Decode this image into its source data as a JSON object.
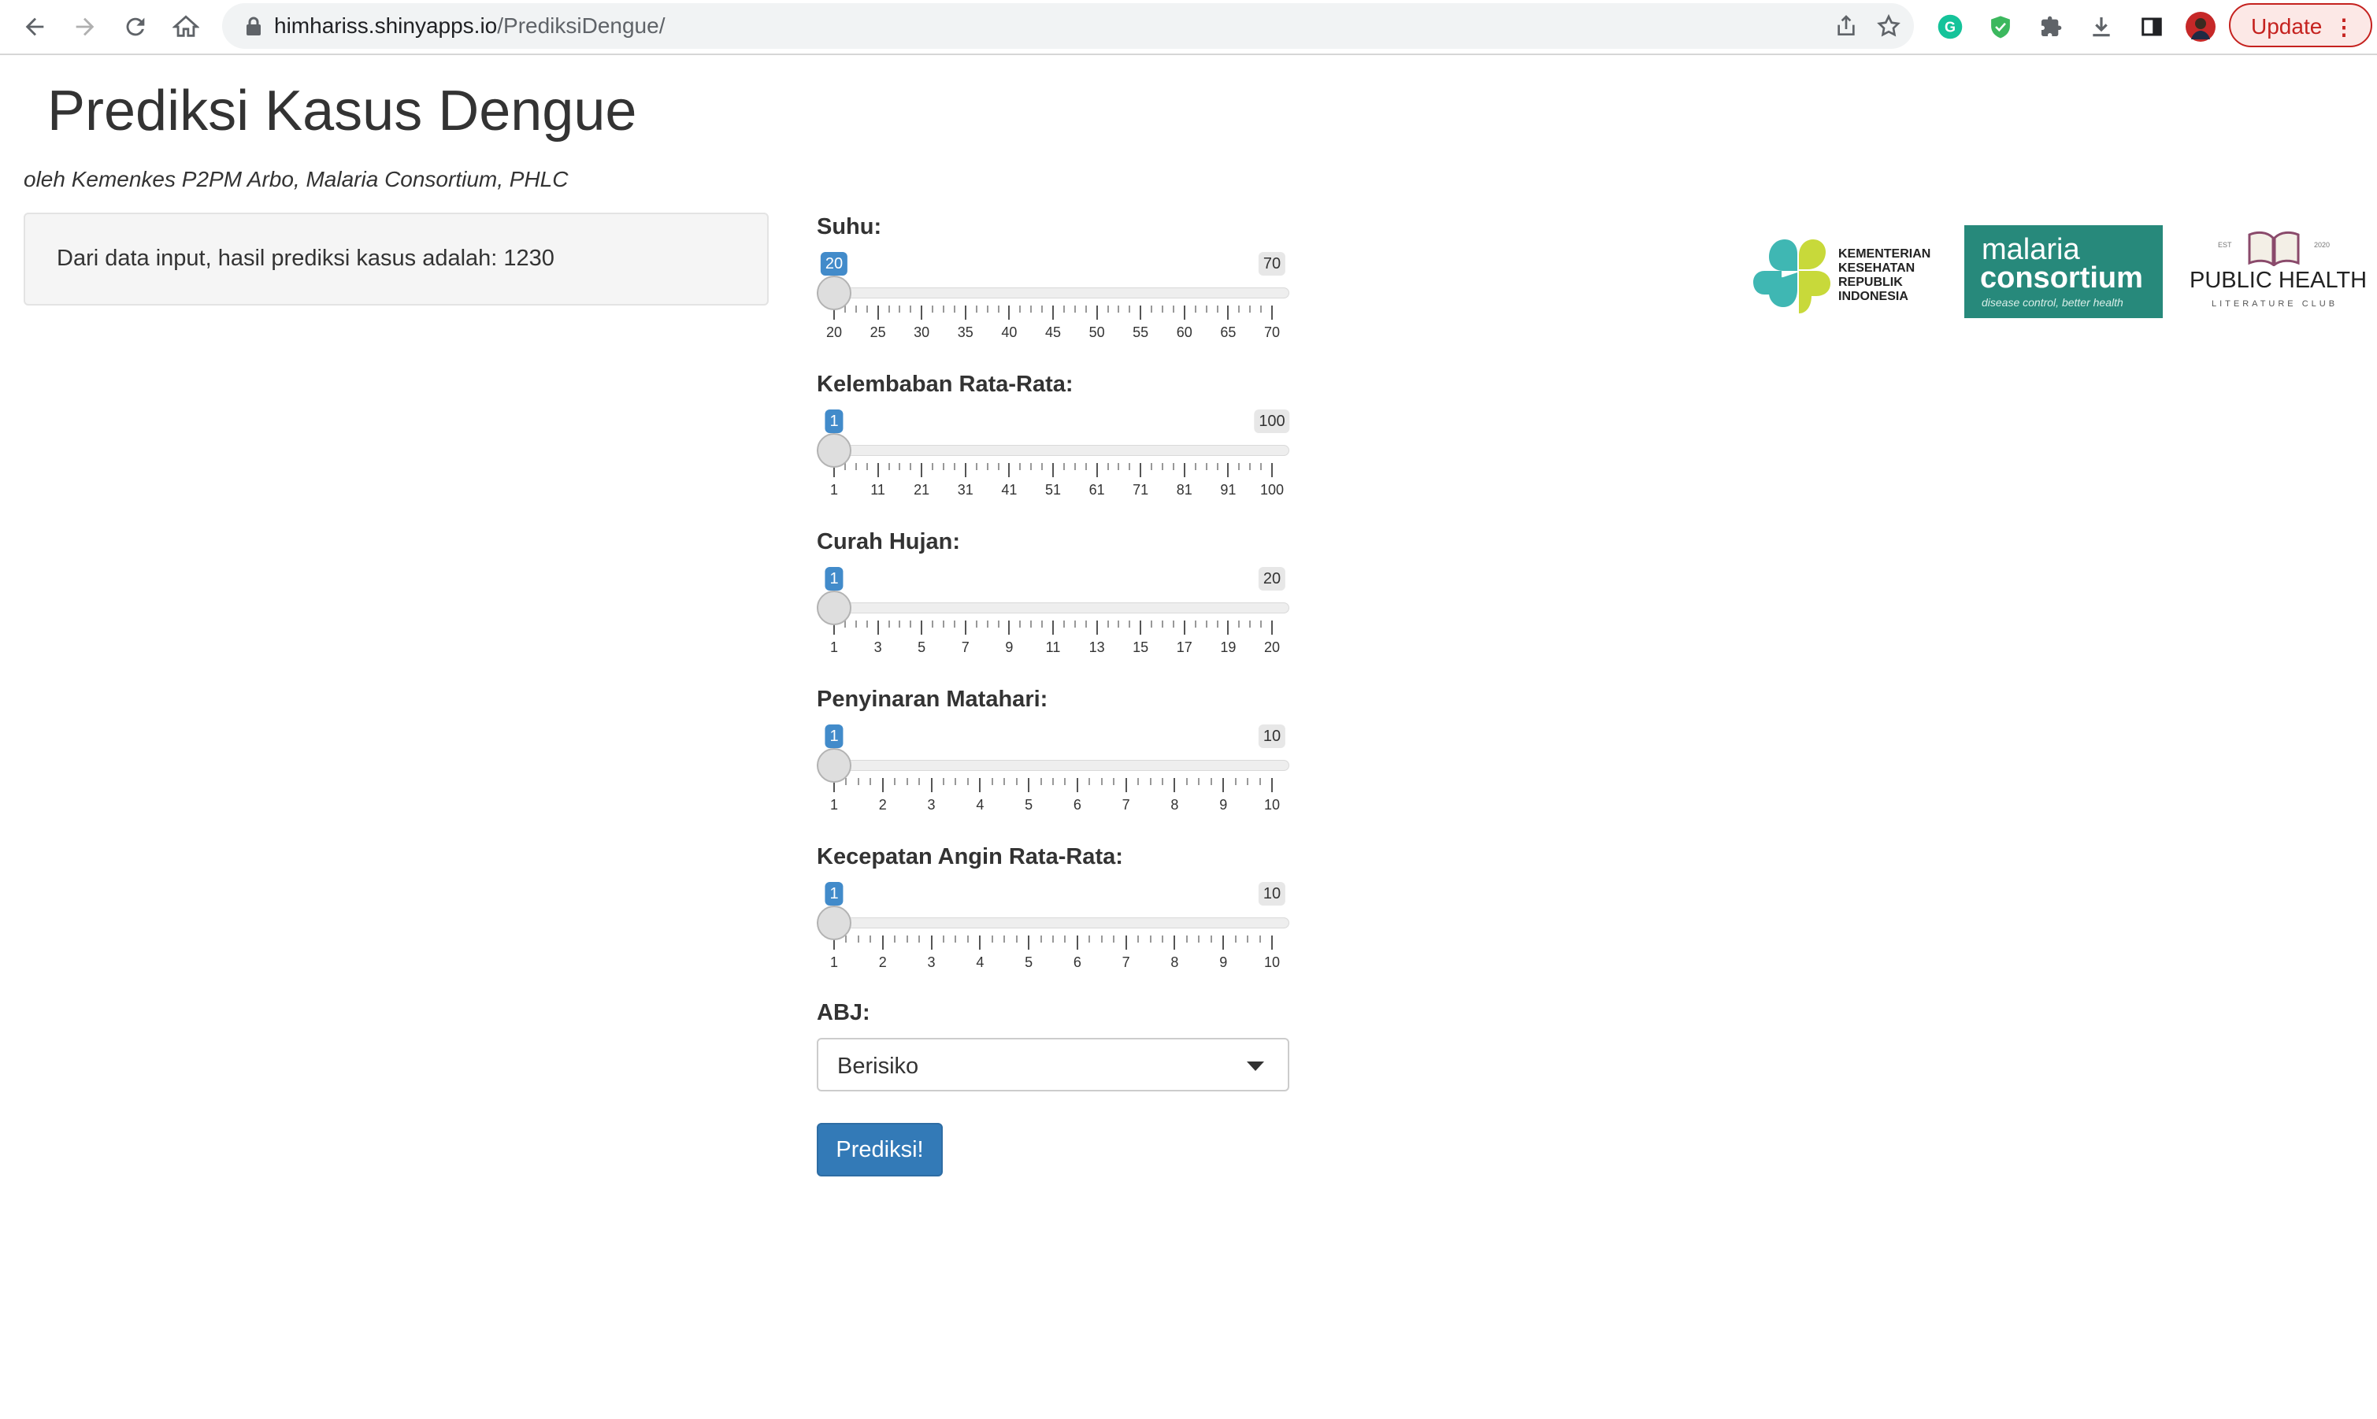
{
  "browser": {
    "url_host": "himhariss.shinyapps.io",
    "url_path": "/PrediksiDengue/",
    "update_label": "Update"
  },
  "page": {
    "title": "Prediksi Kasus Dengue",
    "subtitle": "oleh Kemenkes P2PM Arbo, Malaria Consortium, PHLC",
    "result_text": "Dari data input, hasil prediksi kasus adalah: 1230"
  },
  "sliders": [
    {
      "label": "Suhu:",
      "min": 20,
      "max": 70,
      "value": 20,
      "ticks": [
        "20",
        "25",
        "30",
        "35",
        "40",
        "45",
        "50",
        "55",
        "60",
        "65",
        "70"
      ]
    },
    {
      "label": "Kelembaban Rata-Rata:",
      "min": 1,
      "max": 100,
      "value": 1,
      "ticks": [
        "1",
        "11",
        "21",
        "31",
        "41",
        "51",
        "61",
        "71",
        "81",
        "91",
        "100"
      ]
    },
    {
      "label": "Curah Hujan:",
      "min": 1,
      "max": 20,
      "value": 1,
      "ticks": [
        "1",
        "3",
        "5",
        "7",
        "9",
        "11",
        "13",
        "15",
        "17",
        "19",
        "20"
      ]
    },
    {
      "label": "Penyinaran Matahari:",
      "min": 1,
      "max": 10,
      "value": 1,
      "ticks": [
        "1",
        "2",
        "3",
        "4",
        "5",
        "6",
        "7",
        "8",
        "9",
        "10"
      ]
    },
    {
      "label": "Kecepatan Angin Rata-Rata:",
      "min": 1,
      "max": 10,
      "value": 1,
      "ticks": [
        "1",
        "2",
        "3",
        "4",
        "5",
        "6",
        "7",
        "8",
        "9",
        "10"
      ]
    }
  ],
  "abj": {
    "label": "ABJ:",
    "selected": "Berisiko"
  },
  "predict_button": "Prediksi!",
  "logos": {
    "kemenkes": "KEMENTERIAN KESEHATAN REPUBLIK INDONESIA",
    "malaria_line1": "malaria",
    "malaria_line2": "consortium",
    "malaria_tagline": "disease control, better health",
    "phlc_title": "PUBLIC HEALTH",
    "phlc_sub": "LITERATURE CLUB",
    "phlc_est": "EST",
    "phlc_year": "2020"
  },
  "colors": {
    "primary_button": "#337ab7",
    "slider_bubble": "#428bca",
    "malaria_green": "#27897b",
    "update_red": "#c5221f"
  }
}
